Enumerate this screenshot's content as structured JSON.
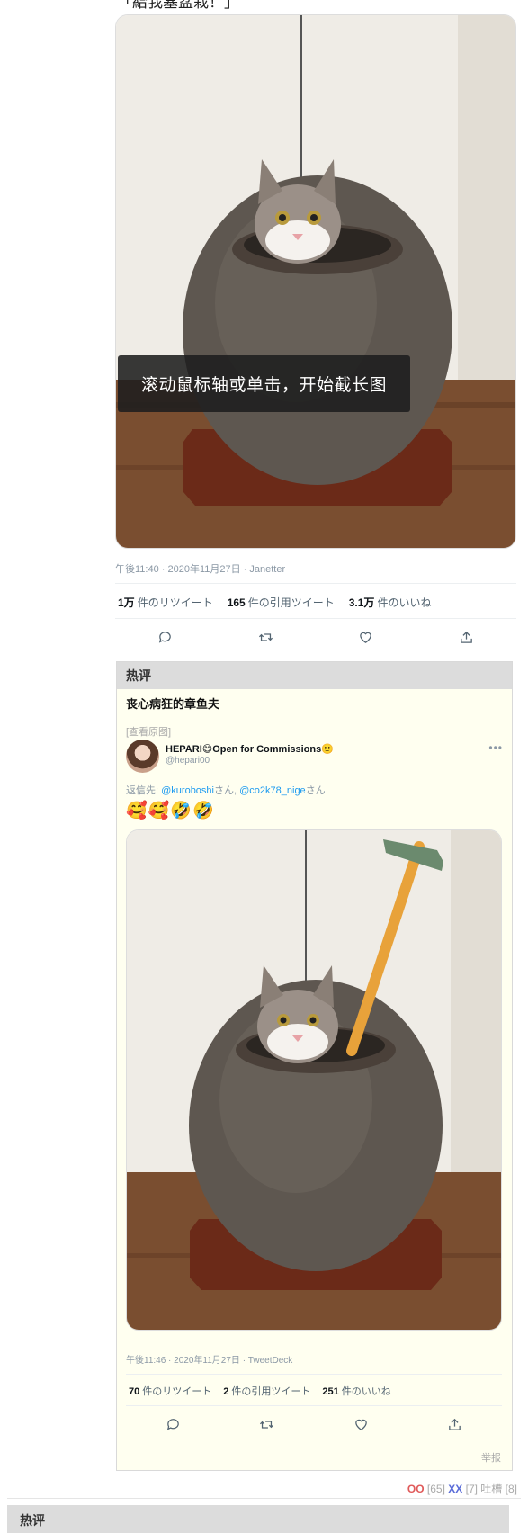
{
  "post": {
    "caption": "「給我塞盆栽！」",
    "overlay_hint": "滚动鼠标轴或单击，开始截长图",
    "tweet": {
      "meta": "午後11:40 · 2020年11月27日 · Janetter",
      "retweets_count": "1万",
      "retweets_label": "件のリツイート",
      "quotes_count": "165",
      "quotes_label": "件の引用ツイート",
      "likes_count": "3.1万",
      "likes_label": "件のいいね"
    }
  },
  "hot_comment": {
    "header": "热评",
    "username": "丧心病狂的章鱼夫",
    "view_original": "[查看原图]",
    "embed": {
      "display_name": "HEPARI😄Open for Commissions🙂",
      "handle": "@hepari00",
      "reply_prefix": "返信先:",
      "reply_user1": "@kuroboshi",
      "reply_honorific1": "さん,",
      "reply_user2": "@co2k78_nige",
      "reply_honorific2": "さん",
      "emojis": "🥰🥰🤣🤣",
      "meta": "午後11:46 · 2020年11月27日 · TweetDeck",
      "retweets_count": "70",
      "retweets_label": "件のリツイート",
      "quotes_count": "2",
      "quotes_label": "件の引用ツイート",
      "likes_count": "251",
      "likes_label": "件のいいね"
    },
    "report": "举报"
  },
  "votes": {
    "oo_label": "OO",
    "oo_count": "[65]",
    "xx_label": "XX",
    "xx_count": "[7]",
    "tucao_label": "吐槽",
    "tucao_count": "[8]"
  },
  "bottom_section": {
    "header": "热评"
  },
  "icons": [
    "reply-icon",
    "retweet-icon",
    "like-icon",
    "share-icon",
    "more-icon"
  ]
}
